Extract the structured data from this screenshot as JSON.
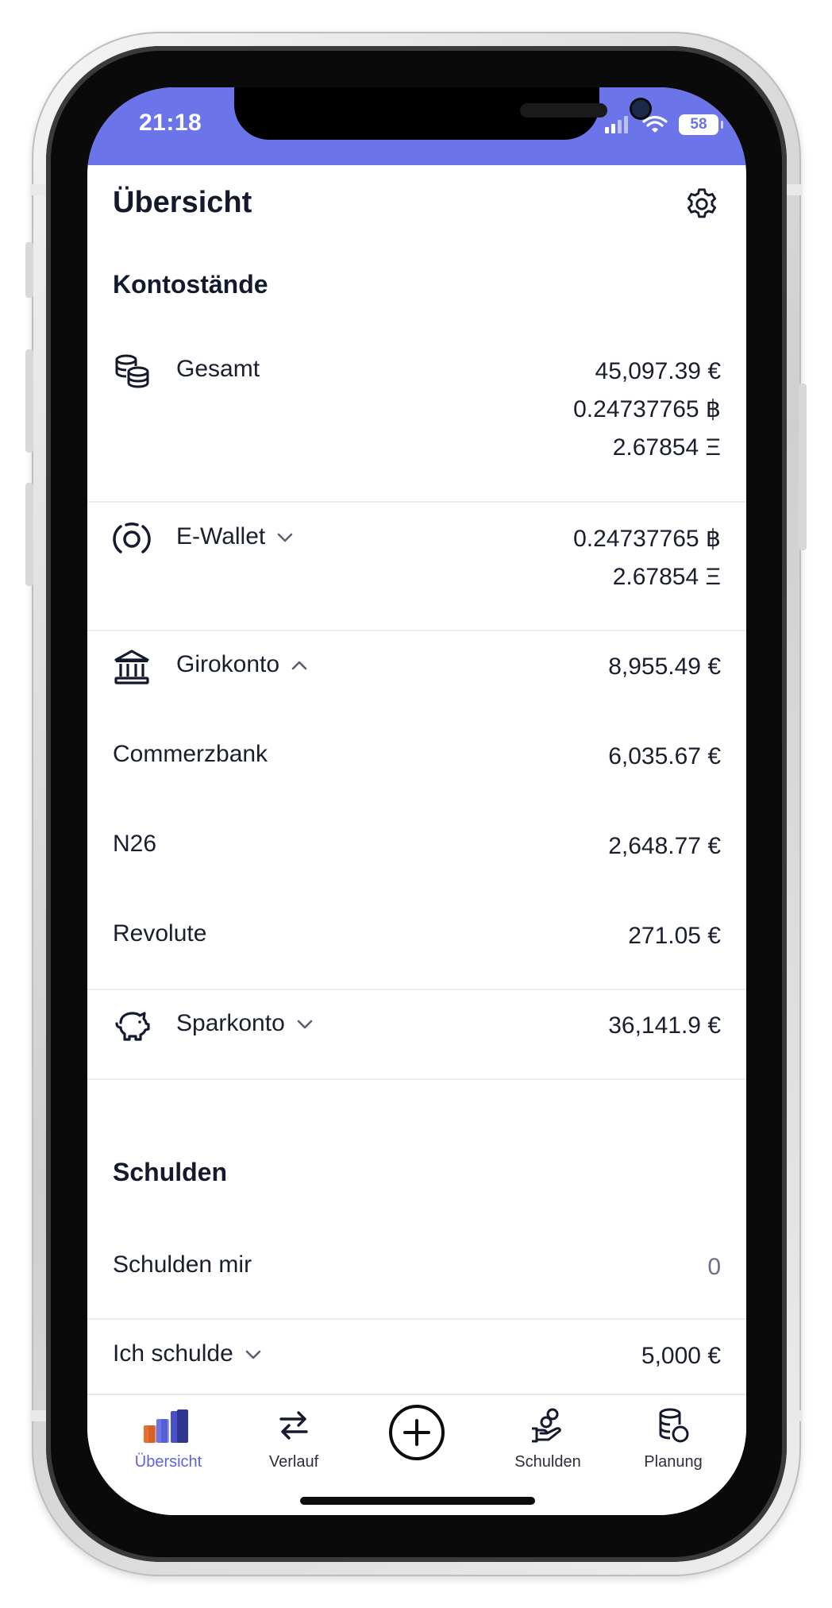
{
  "status_bar": {
    "time": "21:18",
    "battery": "58",
    "accent_color": "#6b74e8"
  },
  "header": {
    "title": "Übersicht",
    "settings_icon": "gear-icon"
  },
  "balances": {
    "section_title": "Kontostände",
    "total": {
      "label": "Gesamt",
      "icon": "coins-icon",
      "amounts": [
        "45,097.39 €",
        "0.24737765 ฿",
        "2.67854 Ξ"
      ]
    },
    "ewallet": {
      "label": "E-Wallet",
      "icon": "wallet-icon",
      "expanded": false,
      "amounts": [
        "0.24737765 ฿",
        "2.67854 Ξ"
      ]
    },
    "girokonto": {
      "label": "Girokonto",
      "icon": "bank-icon",
      "expanded": true,
      "amount": "8,955.49 €",
      "subaccounts": [
        {
          "name": "Commerzbank",
          "amount": "6,035.67 €"
        },
        {
          "name": "N26",
          "amount": "2,648.77 €"
        },
        {
          "name": "Revolute",
          "amount": "271.05 €"
        }
      ]
    },
    "sparkonto": {
      "label": "Sparkonto",
      "icon": "piggy-bank-icon",
      "expanded": false,
      "amount": "36,141.9 €"
    }
  },
  "debts": {
    "section_title": "Schulden",
    "owed_to_me": {
      "label": "Schulden mir",
      "amount": "0"
    },
    "i_owe": {
      "label": "Ich schulde",
      "expanded": false,
      "amount": "5,000 €"
    }
  },
  "tabbar": {
    "active_color": "#5b63dd",
    "tabs": [
      {
        "label": "Übersicht",
        "icon": "bar-chart-icon",
        "active": true
      },
      {
        "label": "Verlauf",
        "icon": "arrows-swap-icon",
        "active": false
      },
      {
        "label": "",
        "icon": "add-circle-icon",
        "active": false
      },
      {
        "label": "Schulden",
        "icon": "hand-coins-icon",
        "active": false
      },
      {
        "label": "Planung",
        "icon": "coin-stack-icon",
        "active": false
      }
    ]
  }
}
